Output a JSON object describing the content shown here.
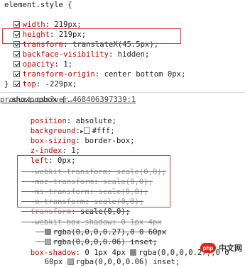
{
  "element_style": {
    "selector": "element.style {",
    "lines": [
      {
        "prop": "width",
        "val": "219px;"
      },
      {
        "prop": "height",
        "val": "219px;"
      },
      {
        "prop": "transform",
        "val": "translateX(45.5px);"
      },
      {
        "prop": "backface-visibility",
        "val": "hidden;"
      },
      {
        "prop": "opacity",
        "val": "1;"
      },
      {
        "prop": "transform-origin",
        "val": "center bottom 0px;"
      },
      {
        "prop": "top",
        "val": "-229px;"
      }
    ],
    "close": "}"
  },
  "showpopbox": {
    "selector": ".showpopbox {",
    "source_link": "product.css?ver…468406397339:1",
    "position": {
      "prop": "position",
      "val": "absolute;"
    },
    "background": {
      "prop": "background",
      "val": "#fff;"
    },
    "box_sizing": {
      "prop": "box-sizing",
      "val": "border-box;"
    },
    "z_index": {
      "prop": "z-index",
      "val": "1;"
    },
    "left": {
      "prop": "left",
      "val": "0px;"
    },
    "webkit_transform": {
      "prop": "-webkit-transform",
      "val": "scale(0,0);"
    },
    "moz_transform": {
      "prop": "-moz-transform",
      "val": "scale(0,0);"
    },
    "ms_transform": {
      "prop": "-ms-transform",
      "val": "scale(0,0);"
    },
    "o_transform": {
      "prop": "-o-transform",
      "val": "scale(0,0);"
    },
    "transform": {
      "prop": "transform",
      "val": "scale(0,0);"
    },
    "webkit_box_shadow": {
      "prop": "-webkit-box-shadow",
      "val": "0 1px 4px"
    },
    "webkit_box_shadow_2": "rgba(0,0,0,0.27),0 0 60px",
    "webkit_box_shadow_3": "rgba(0,0,0,0.06) inset;",
    "box_shadow": {
      "prop": "box-shadow",
      "val": "0 1px 4px",
      "val2": "rgba(0,0,0,0.27),0 0"
    },
    "box_shadow_2a": "60px",
    "box_shadow_2b": "rgba(0,0,0,0.06) inset;"
  },
  "watermark": {
    "logo": "php",
    "text": "中文网"
  }
}
